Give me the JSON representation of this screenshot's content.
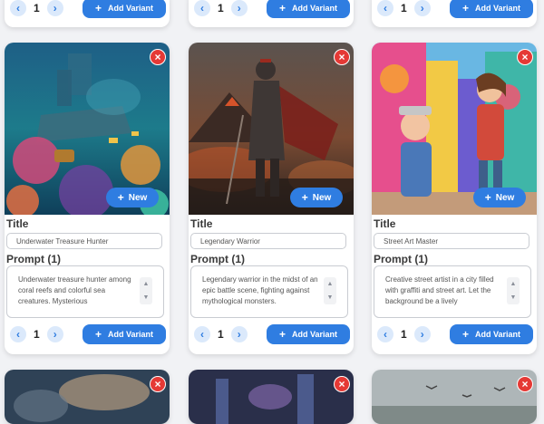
{
  "cards": [
    {
      "title_label": "Title",
      "title_value": "Underwater Treasure Hunter",
      "prompt_label": "Prompt (1)",
      "prompt_text": "Underwater treasure hunter among coral reefs and colorful sea creatures. Mysterious",
      "count": "1",
      "new_label": "New",
      "add_label": "Add Variant"
    },
    {
      "title_label": "Title",
      "title_value": "Legendary Warrior",
      "prompt_label": "Prompt (1)",
      "prompt_text": "Legendary warrior in the midst of an epic battle scene, fighting against mythological monsters.",
      "count": "1",
      "new_label": "New",
      "add_label": "Add Variant"
    },
    {
      "title_label": "Title",
      "title_value": "Street Art Master",
      "prompt_label": "Prompt (1)",
      "prompt_text": "Creative street artist in a city filled with graffiti and street art. Let the background be a lively",
      "count": "1",
      "new_label": "New",
      "add_label": "Add Variant"
    }
  ],
  "top_row": [
    {
      "count": "1",
      "add_label": "Add Variant"
    },
    {
      "count": "1",
      "add_label": "Add Variant"
    },
    {
      "count": "1",
      "add_label": "Add Variant"
    }
  ],
  "icons": {
    "close": "×",
    "prev": "‹",
    "next": "›",
    "plus": "+",
    "scroll_up": "▲",
    "scroll_down": "▼"
  },
  "colors": {
    "accent": "#2f7de1",
    "close": "#e53935",
    "background": "#f1f2f5"
  }
}
